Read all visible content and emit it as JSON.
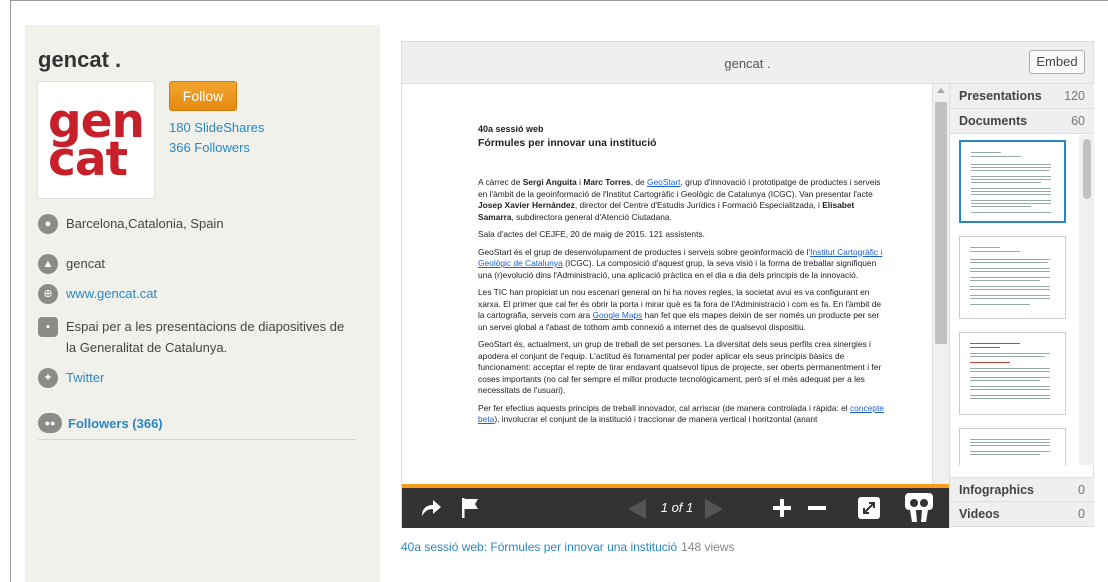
{
  "profile": {
    "name": "gencat .",
    "logo_line1": "gen",
    "logo_line2": "cat",
    "follow_label": "Follow",
    "slideshares": "180 SlideShares",
    "followers_link": "366 Followers",
    "location": "Barcelona,Catalonia, Spain",
    "org_name": "gencat",
    "website": "www.gencat.cat",
    "description": "Espai per a les presentacions de diapositives de la Generalitat de Catalunya.",
    "twitter": "Twitter",
    "followers_section": "Followers (366)"
  },
  "player": {
    "title": "gencat .",
    "embed_label": "Embed",
    "pager": "1 of 1"
  },
  "document": {
    "heading1": "40a sessió web",
    "heading2": "Fórmules per innovar una institució",
    "p1_a": "A càrrec de ",
    "p1_b": "Sergi Anguita",
    "p1_c": " i ",
    "p1_d": "Marc Torres",
    "p1_e": ", de ",
    "p1_link": "GeoStart",
    "p1_f": ", grup d'innovació i prototipatge de productes i serveis en l'àmbit de la geoinformació de l'Institut Cartogràfic i Geològic de Catalunya (ICGC). Van presentar l'acte ",
    "p1_g": "Josep Xavier Hernández",
    "p1_h": ", director del Centre d'Estudis Jurídics i Formació Especialitzada, i ",
    "p1_i": "Elisabet Samarra",
    "p1_j": ", subdirectora general d'Atenció Ciutadana.",
    "p2": "Sala d'actes del CEJFE, 20 de maig de 2015. 121 assistents.",
    "p3_a": "GeoStart és el grup de desenvolupament de productes i serveis sobre geoinformació de l'",
    "p3_link": "Institut Cartogràfic i Geològic de Catalunya",
    "p3_b": " (ICGC). La composició d'aquest grup, la seva visió i la forma de treballar signifiquen una (r)evolució dins l'Administració, una aplicació pràctica en el dia a dia dels principis de la innovació.",
    "p4_a": "Les TIC han propiciat un nou escenari general on hi ha noves regles, la societat avui es va configurant en xarxa. El primer que cal fer és obrir la porta i mirar què es fa fora de l'Administració i com es fa. En l'àmbit de la cartografia, serveis com ara ",
    "p4_link": "Google Maps",
    "p4_b": " han fet que els mapes deixin de ser només un producte per ser un servei global a l'abast de tothom amb connexió a internet des de qualsevol dispositiu.",
    "p5": "GeoStart és, actualment, un grup de treball de set persones. La diversitat dels seus perfils crea sinergies i apodera el conjunt de l'equip. L'actitud és fonamental per poder aplicar els seus principis bàsics de funcionament: acceptar el repte de tirar endavant qualsevol tipus de projecte, ser oberts permanentment i fer coses importants (no cal fer sempre el millor producte tecnològicament, però sí el més adequat per a les necessitats de l'usuari).",
    "p6_a": "Per fer efectius aquests principis de treball innovador, cal arriscar (de manera controlada i ràpida: el ",
    "p6_link": "concepte beta",
    "p6_b": "), involucrar el conjunt de la institució i traccionar de manera vertical i horitzontal (anant"
  },
  "panel": {
    "presentations_label": "Presentations",
    "presentations_count": "120",
    "documents_label": "Documents",
    "documents_count": "60",
    "infographics_label": "Infographics",
    "infographics_count": "0",
    "videos_label": "Videos",
    "videos_count": "0"
  },
  "caption": {
    "title": "40a sessió web: Fórmules per innovar una institució",
    "views": "148 views"
  },
  "colors": {
    "link": "#2b87c4",
    "follow": "#f0a12b",
    "logo_red": "#c8202a",
    "progress": "#f59d1b"
  }
}
